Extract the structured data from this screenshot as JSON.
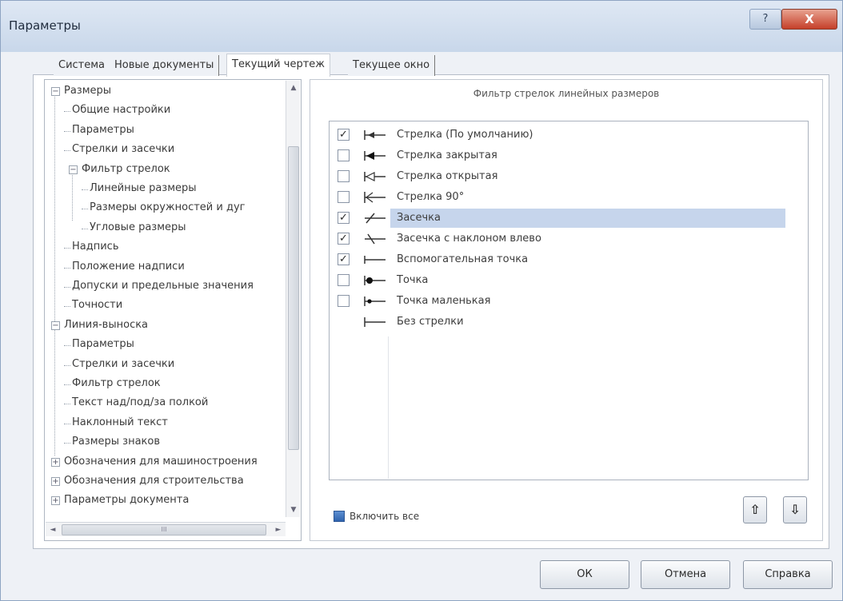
{
  "window": {
    "title": "Параметры",
    "help_glyph": "?",
    "close_glyph": "X"
  },
  "tabs": [
    {
      "label": "Система"
    },
    {
      "label": "Новые документы"
    },
    {
      "label": "Текущий чертеж"
    },
    {
      "label": "Текущее окно"
    }
  ],
  "tree": {
    "items": [
      {
        "label": "Размеры",
        "expander": "−"
      },
      {
        "label": "Общие настройки"
      },
      {
        "label": "Параметры"
      },
      {
        "label": "Стрелки и засечки"
      },
      {
        "label": "Фильтр стрелок",
        "expander": "−"
      },
      {
        "label": "Линейные размеры"
      },
      {
        "label": "Размеры окружностей и дуг"
      },
      {
        "label": "Угловые размеры"
      },
      {
        "label": "Надпись"
      },
      {
        "label": "Положение надписи"
      },
      {
        "label": "Допуски и предельные значения"
      },
      {
        "label": "Точности"
      },
      {
        "label": "Линия-выноска",
        "expander": "−"
      },
      {
        "label": "Параметры"
      },
      {
        "label": "Стрелки и засечки"
      },
      {
        "label": "Фильтр стрелок"
      },
      {
        "label": "Текст над/под/за полкой"
      },
      {
        "label": "Наклонный текст"
      },
      {
        "label": "Размеры знаков"
      },
      {
        "label": "Обозначения для машиностроения",
        "expander": "+"
      },
      {
        "label": "Обозначения для строительства",
        "expander": "+"
      },
      {
        "label": "Параметры документа",
        "expander": "+"
      }
    ],
    "scroll_up": "▲",
    "scroll_down": "▼",
    "scroll_left": "◄",
    "scroll_right": "►",
    "hthumb_grip": "III"
  },
  "panel": {
    "header": "Фильтр стрелок линейных размеров",
    "arrows": [
      {
        "label": "Стрелка (По умолчанию)",
        "checked": true,
        "glyph": "arrow-default"
      },
      {
        "label": "Стрелка закрытая",
        "checked": false,
        "glyph": "arrow-closed"
      },
      {
        "label": "Стрелка открытая",
        "checked": false,
        "glyph": "arrow-open"
      },
      {
        "label": "Стрелка 90°",
        "checked": false,
        "glyph": "arrow-90"
      },
      {
        "label": "Засечка",
        "checked": true,
        "glyph": "tick",
        "selected": true
      },
      {
        "label": "Засечка с наклоном влево",
        "checked": true,
        "glyph": "tick-left"
      },
      {
        "label": "Вспомогательная точка",
        "checked": true,
        "glyph": "aux-point"
      },
      {
        "label": "Точка",
        "checked": false,
        "glyph": "dot"
      },
      {
        "label": "Точка маленькая",
        "checked": false,
        "glyph": "dot-small"
      },
      {
        "label": "Без стрелки",
        "checked": null,
        "glyph": "none"
      }
    ],
    "check_glyph": "✓",
    "enable_all": "Включить все",
    "move_up": "⇧",
    "move_down": "⇩"
  },
  "buttons": {
    "ok": "ОК",
    "cancel": "Отмена",
    "help": "Справка"
  },
  "colors": {
    "selection": "#c6d5ec",
    "titlebar": "#c8d7ea",
    "close": "#c5402a"
  }
}
